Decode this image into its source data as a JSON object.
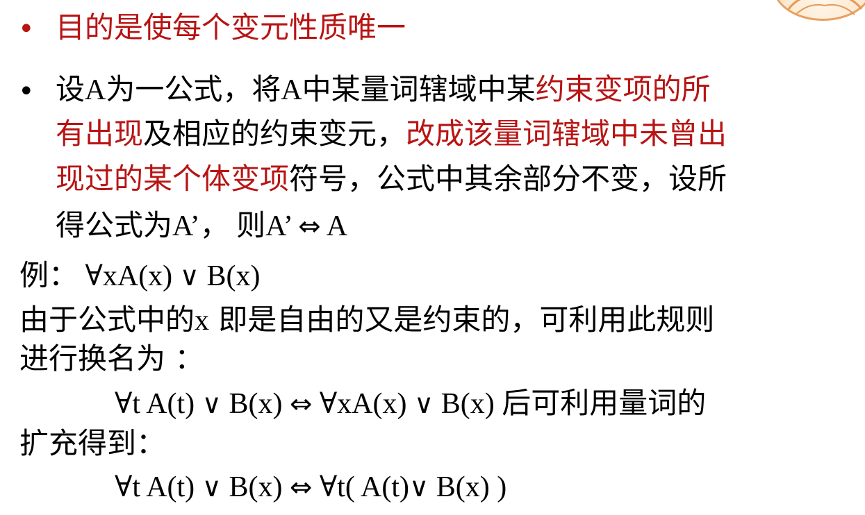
{
  "bullet_char": "•",
  "bullet1": {
    "text": "目的是使每个变元性质唯一",
    "color": "#b81414"
  },
  "bullet2": {
    "line1_a": "设A为一公式，将A中某量词辖域中某",
    "line1_b": "约束变项的所",
    "line2_a": "有出现",
    "line2_b": "及相应的约束变元，",
    "line2_c": "改成该量词辖域中未曾出",
    "line3_a": "现过的某个体变项",
    "line3_b": "符号，公式中其余部分不变，设所",
    "line4_a": "得公式为A’， 则A’ ",
    "line4_sym": "⇔",
    "line4_b": "  A"
  },
  "example": {
    "label": "例：",
    "formula_a": " ∀xA(x) ",
    "formula_or": "∨",
    "formula_b": " B(x)",
    "desc1_a": "由于公式中的",
    "desc1_x": "x",
    "desc1_b": " 即是自由的又是约束的，可利用此规则",
    "desc2": "进行换名为 ：",
    "eq1_a": "∀t A(t) ",
    "eq1_or1": "∨",
    "eq1_b": " B(x) ",
    "eq1_iff": "⇔",
    "eq1_c": " ∀xA(x) ",
    "eq1_or2": "∨",
    "eq1_d": " B(x) ",
    "eq1_tail": " 后可利用量词的",
    "desc3": "扩充得到：",
    "eq2_a": "∀t A(t) ",
    "eq2_or1": "∨",
    "eq2_b": " B(x) ",
    "eq2_iff": "⇔",
    "eq2_c": " ∀t( A(t)",
    "eq2_or2": "∨",
    "eq2_d": " B(x) )"
  },
  "logo_icon": "decorative-seal-icon",
  "accent_color": "#b81414"
}
